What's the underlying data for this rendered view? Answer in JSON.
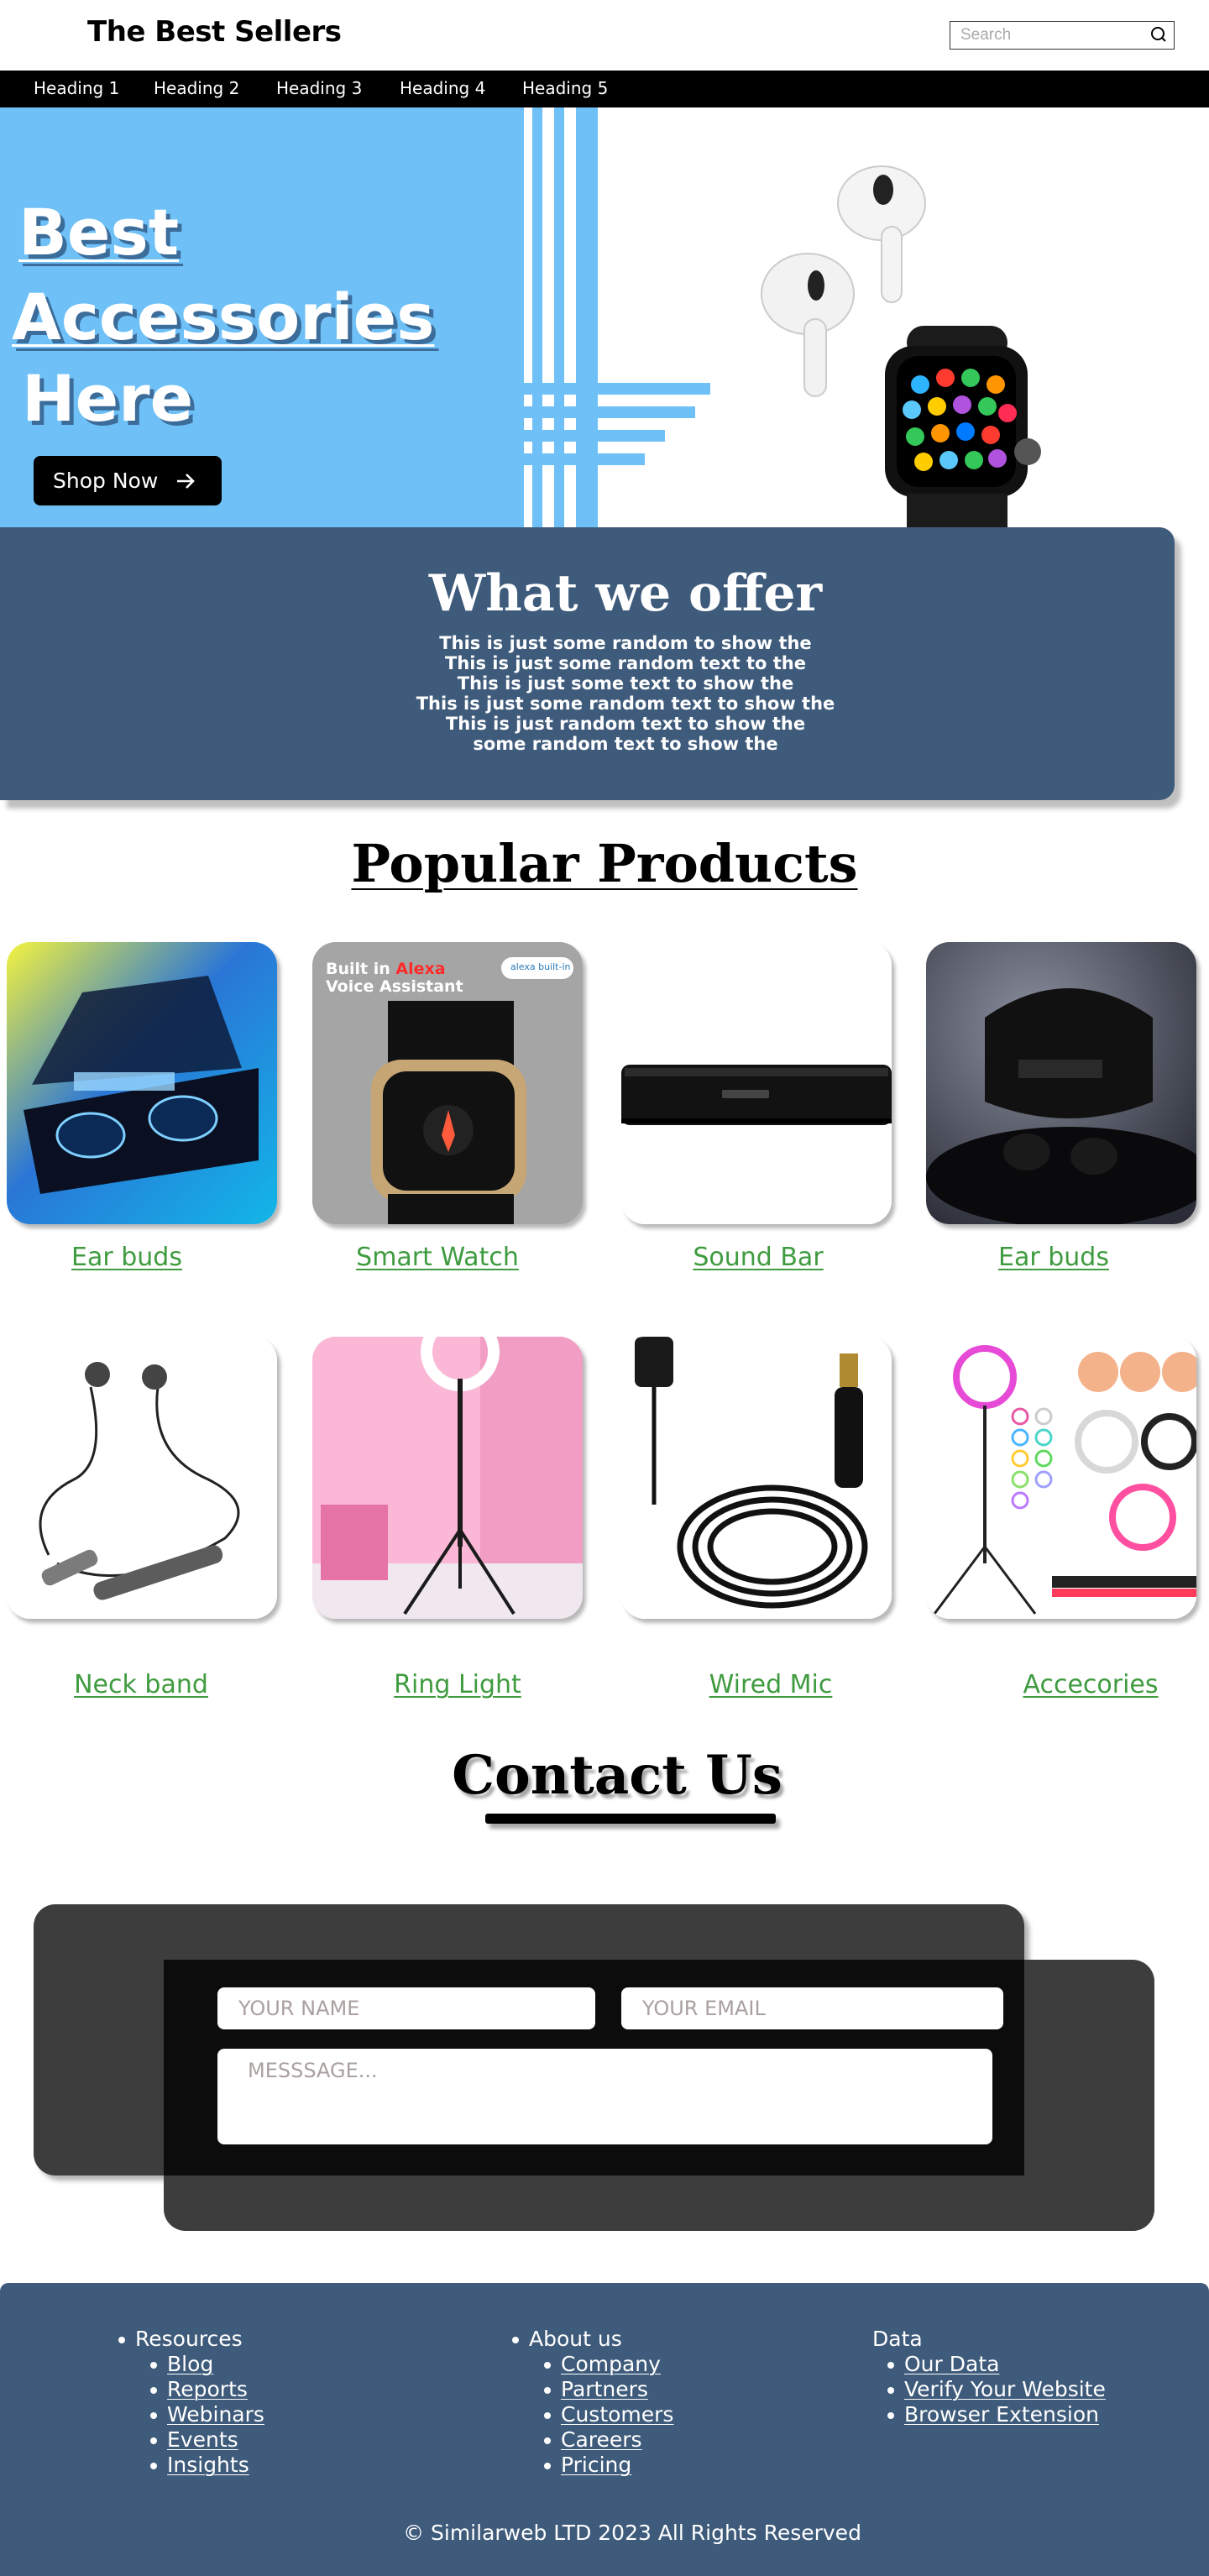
{
  "header": {
    "brand": "The Best Sellers",
    "search_placeholder": "Search"
  },
  "nav": {
    "items": [
      "Heading 1",
      "Heading 2",
      "Heading 3",
      "Heading 4",
      "Heading 5"
    ]
  },
  "hero": {
    "title_lines": [
      "Best",
      "Accessories",
      "Here"
    ],
    "shop_button": "Shop Now",
    "accent_color": "#6ec0f7"
  },
  "offer": {
    "title": "What we offer",
    "lines": [
      "This is just some random to show the",
      "This is just some random text to  the",
      "This is just some text to show the",
      "This is just some random text to show the",
      "This is just random text to show the",
      "some random text to show the"
    ],
    "background": "#3f5b7b"
  },
  "products": {
    "title": "Popular Products",
    "items": [
      {
        "name": "Ear buds",
        "icon": "earbuds-case-image"
      },
      {
        "name": "Smart Watch",
        "icon": "smart-watch-image",
        "overlay_line1_a": "Built in ",
        "overlay_line1_b": "Alexa",
        "overlay_line2": "Voice Assistant",
        "badge": "alexa built-in"
      },
      {
        "name": "Sound Bar",
        "icon": "sound-bar-image"
      },
      {
        "name": "Ear buds",
        "icon": "earbuds-dock-image"
      },
      {
        "name": "Neck band",
        "icon": "neckband-image"
      },
      {
        "name": "Ring Light",
        "icon": "ring-light-image"
      },
      {
        "name": "Wired Mic",
        "icon": "wired-mic-image"
      },
      {
        "name": "Accecories",
        "icon": "accessories-image"
      }
    ],
    "label_color": "#3f9b3f"
  },
  "contact": {
    "title": "Contact Us",
    "name_placeholder": "YOUR NAME",
    "email_placeholder": "YOUR EMAIL",
    "message_placeholder": "MESSSAGE..."
  },
  "footer": {
    "columns": [
      {
        "title": "Resources",
        "links": [
          "Blog",
          "Reports",
          "Webinars",
          "Events",
          "Insights"
        ]
      },
      {
        "title": "About us",
        "links": [
          "Company",
          "Partners",
          "Customers",
          "Careers",
          "Pricing"
        ]
      },
      {
        "title": "Data",
        "links": [
          "Our Data",
          "Verify Your Website",
          "Browser Extension"
        ]
      }
    ],
    "copyright": "© Similarweb LTD 2023 All Rights Reserved",
    "background": "#3f5b7b"
  }
}
